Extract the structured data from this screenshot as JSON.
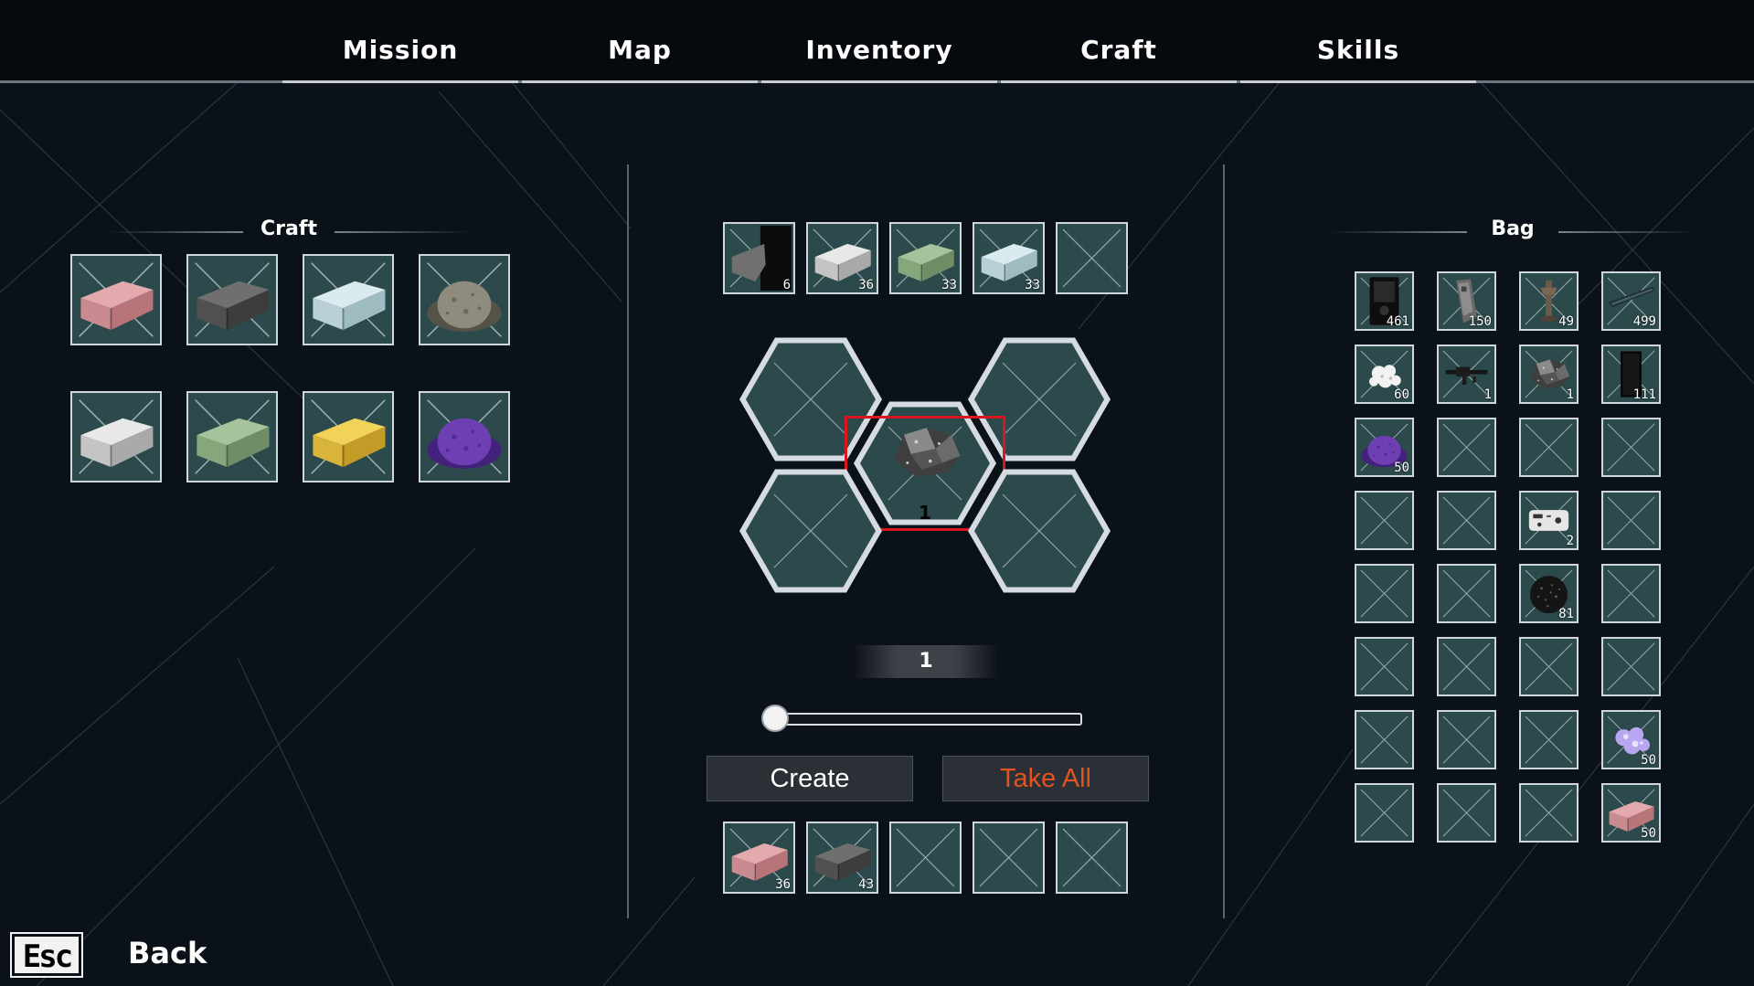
{
  "nav": {
    "tabs": [
      {
        "label": "Mission"
      },
      {
        "label": "Map"
      },
      {
        "label": "Inventory"
      },
      {
        "label": "Craft"
      },
      {
        "label": "Skills"
      }
    ]
  },
  "craft_panel": {
    "title": "Craft",
    "recipes": [
      {
        "item": "ingot-pink"
      },
      {
        "item": "ingot-darkgray"
      },
      {
        "item": "ingot-lightblue"
      },
      {
        "item": "powder-gray"
      },
      {
        "item": "ingot-silver"
      },
      {
        "item": "ingot-green"
      },
      {
        "item": "ingot-gold"
      },
      {
        "item": "powder-purple"
      }
    ]
  },
  "workbench": {
    "input_slots": [
      {
        "item": "ingot-darkgray-partial",
        "count": "6"
      },
      {
        "item": "ingot-silver",
        "count": "36"
      },
      {
        "item": "ingot-green",
        "count": "33"
      },
      {
        "item": "ingot-lightblue",
        "count": "33"
      },
      {
        "item": "",
        "count": ""
      }
    ],
    "hex_slots": [
      {
        "item": ""
      },
      {
        "item": ""
      },
      {
        "item": "ore-rock",
        "count": "1",
        "selected": true
      },
      {
        "item": ""
      },
      {
        "item": ""
      }
    ],
    "quantity": "1",
    "slider_value": 0,
    "create_label": "Create",
    "take_all_label": "Take All",
    "output_slots": [
      {
        "item": "ingot-pink",
        "count": "36"
      },
      {
        "item": "ingot-darkgray",
        "count": "43"
      },
      {
        "item": "",
        "count": ""
      },
      {
        "item": "",
        "count": ""
      },
      {
        "item": "",
        "count": ""
      }
    ]
  },
  "bag": {
    "title": "Bag",
    "slots": [
      {
        "item": "black-case",
        "count": "461"
      },
      {
        "item": "ammo-clip",
        "count": "150"
      },
      {
        "item": "bolt",
        "count": "49"
      },
      {
        "item": "blade",
        "count": "499"
      },
      {
        "item": "white-crystals",
        "count": "60"
      },
      {
        "item": "rifle",
        "count": "1"
      },
      {
        "item": "ore-rock",
        "count": "1"
      },
      {
        "item": "black-panel",
        "count": "111"
      },
      {
        "item": "powder-purple",
        "count": "50"
      },
      {
        "item": "",
        "count": ""
      },
      {
        "item": "",
        "count": ""
      },
      {
        "item": "",
        "count": ""
      },
      {
        "item": "",
        "count": ""
      },
      {
        "item": "",
        "count": ""
      },
      {
        "item": "controller",
        "count": "2"
      },
      {
        "item": "",
        "count": ""
      },
      {
        "item": "",
        "count": ""
      },
      {
        "item": "",
        "count": ""
      },
      {
        "item": "black-granules",
        "count": "81"
      },
      {
        "item": "",
        "count": ""
      },
      {
        "item": "",
        "count": ""
      },
      {
        "item": "",
        "count": ""
      },
      {
        "item": "",
        "count": ""
      },
      {
        "item": "",
        "count": ""
      },
      {
        "item": "",
        "count": ""
      },
      {
        "item": "",
        "count": ""
      },
      {
        "item": "",
        "count": ""
      },
      {
        "item": "purple-crystals",
        "count": "50"
      },
      {
        "item": "",
        "count": ""
      },
      {
        "item": "",
        "count": ""
      },
      {
        "item": "",
        "count": ""
      },
      {
        "item": "ingot-pink",
        "count": "50"
      }
    ]
  },
  "footer": {
    "key_label": "Esc",
    "back_label": "Back"
  },
  "colors": {
    "background": "#0b1118",
    "slot_fill": "#2c4a4c",
    "slot_border": "#cfd6dc",
    "selection": "#d8161d",
    "take_all_text": "#e2531d"
  }
}
